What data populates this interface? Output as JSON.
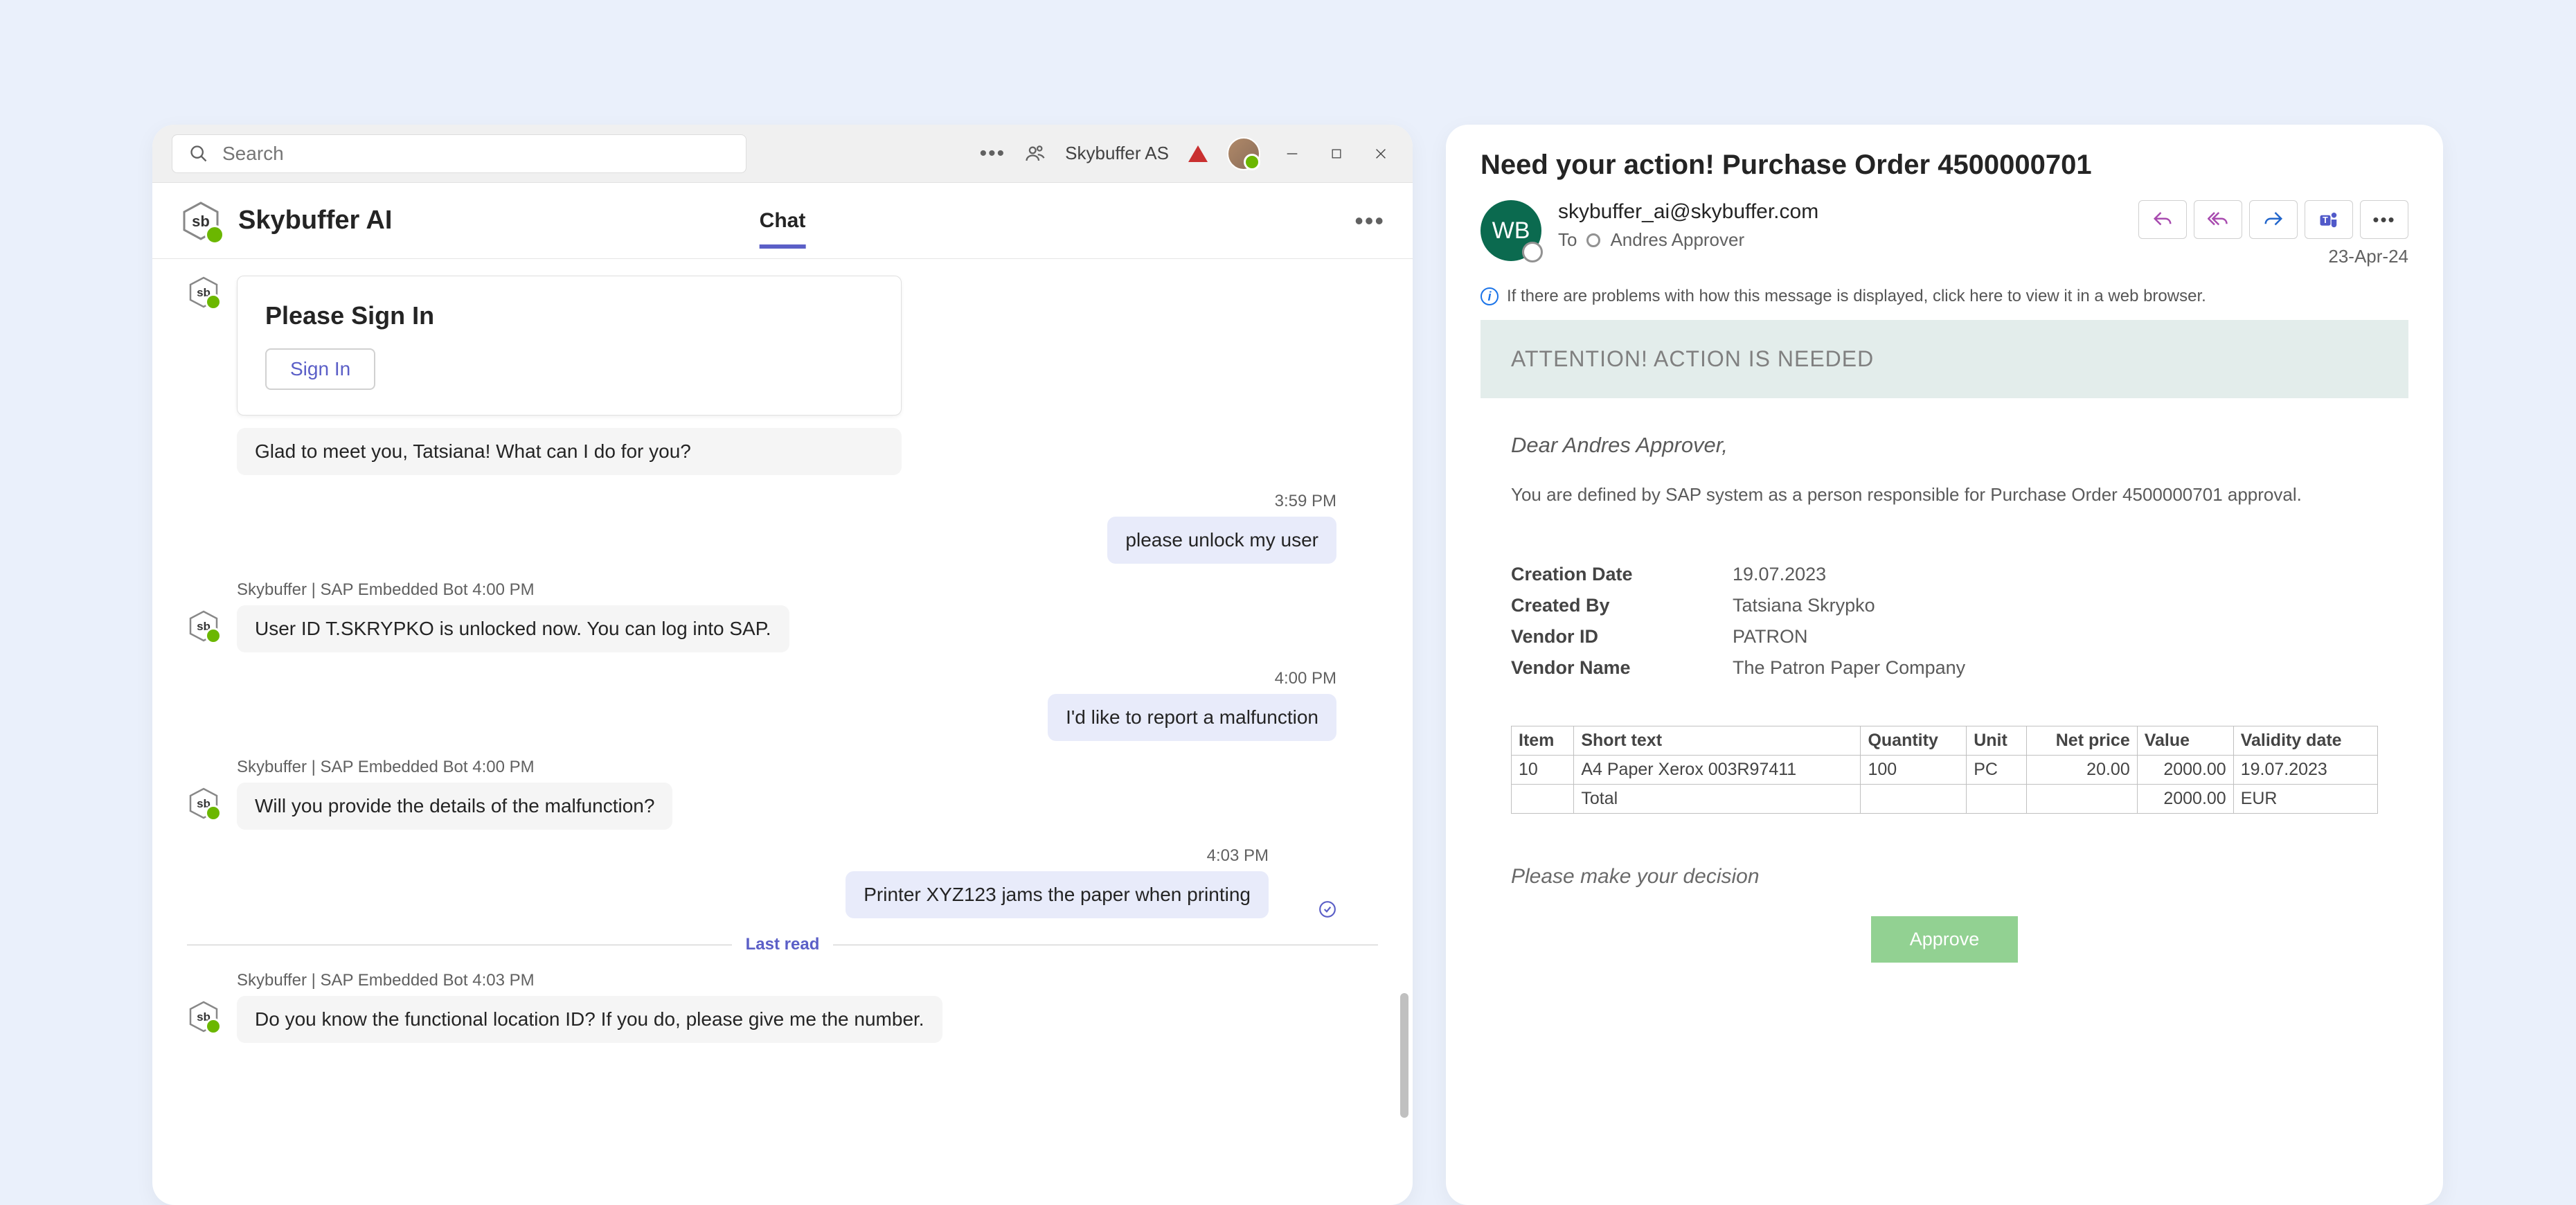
{
  "teams": {
    "search_placeholder": "Search",
    "org_name": "Skybuffer AS",
    "app_title": "Skybuffer AI",
    "tab_chat": "Chat"
  },
  "chat": {
    "signin_card_title": "Please Sign In",
    "signin_button": "Sign In",
    "greeting_msg": "Glad to meet you, Tatsiana! What can I do for you?",
    "m1_time": "3:59 PM",
    "m1_text": "please unlock my user",
    "b2_label": "Skybuffer | SAP Embedded Bot  4:00 PM",
    "b2_text": "User ID T.SKRYPKO is unlocked now. You can log into SAP.",
    "m2_time": "4:00 PM",
    "m2_text": "I'd like to report a malfunction",
    "b3_label": "Skybuffer | SAP Embedded Bot  4:00 PM",
    "b3_text": "Will you provide the details of the malfunction?",
    "m3_time": "4:03 PM",
    "m3_text": "Printer XYZ123 jams the paper when printing",
    "last_read": "Last read",
    "b4_label": "Skybuffer | SAP Embedded Bot  4:03 PM",
    "b4_text": "Do you know the functional location ID? If you do, please give me the number."
  },
  "email": {
    "subject": "Need your action! Purchase Order 4500000701",
    "avatar_initials": "WB",
    "from": "skybuffer_ai@skybuffer.com",
    "to_label": "To",
    "to_name": "Andres Approver",
    "date": "23-Apr-24",
    "info_text": "If there are problems with how this message is displayed, click here to view it in a web browser.",
    "banner": "ATTENTION! ACTION IS NEEDED",
    "greeting": "Dear Andres Approver,",
    "body": "You are defined by SAP system as a person responsible for Purchase Order 4500000701 approval.",
    "details": {
      "creation_date_label": "Creation Date",
      "creation_date": "19.07.2023",
      "created_by_label": "Created By",
      "created_by": "Tatsiana Skrypko",
      "vendor_id_label": "Vendor ID",
      "vendor_id": "PATRON",
      "vendor_name_label": "Vendor Name",
      "vendor_name": "The Patron Paper Company"
    },
    "table": {
      "h_item": "Item",
      "h_short": "Short text",
      "h_qty": "Quantity",
      "h_unit": "Unit",
      "h_net": "Net price",
      "h_value": "Value",
      "h_validity": "Validity date",
      "r1_item": "10",
      "r1_short": "A4 Paper Xerox 003R97411",
      "r1_qty": "100",
      "r1_unit": "PC",
      "r1_net": "20.00",
      "r1_value": "2000.00",
      "r1_validity": "19.07.2023",
      "total_label": "Total",
      "total_value": "2000.00",
      "total_cur": "EUR"
    },
    "decision": "Please make your decision",
    "approve": "Approve"
  }
}
